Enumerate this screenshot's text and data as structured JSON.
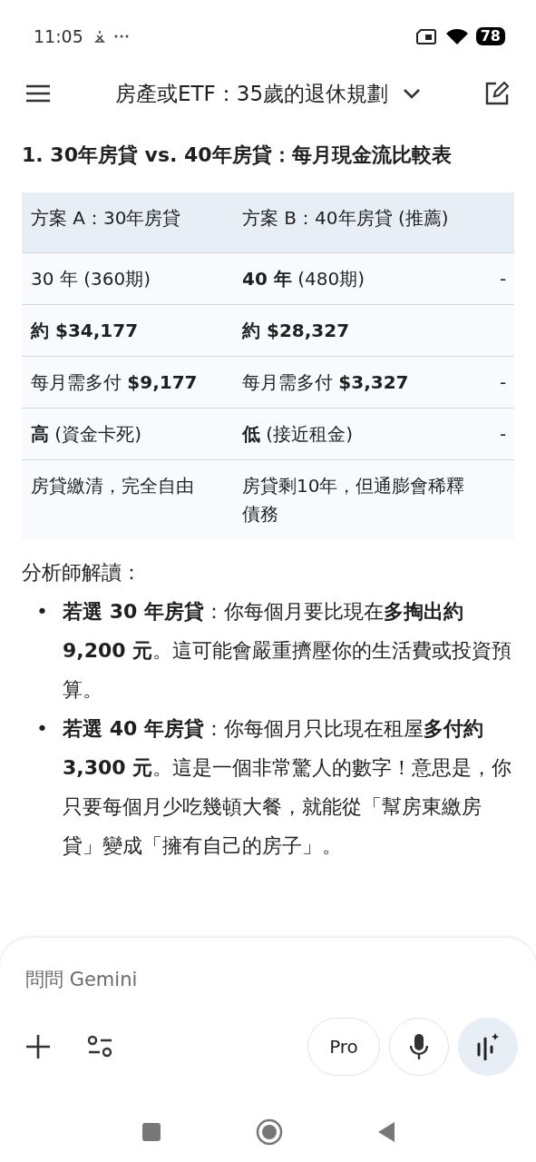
{
  "status_bar": {
    "time": "11:05",
    "battery": "78"
  },
  "app_bar": {
    "title": "房產或ETF：35歲的退休規劃"
  },
  "response": {
    "heading": "1. 30年房貸 vs. 40年房貸：每月現金流比較表",
    "table": {
      "columns": [
        "方案 A：30年房貸",
        "方案 B：40年房貸 (推薦)"
      ],
      "rows": [
        {
          "a": "30 年 (360期)",
          "b": "**40 年** (480期)",
          "column_3": "-"
        },
        {
          "a": "**約 $34,177**",
          "b": "**約 $28,327**"
        },
        {
          "a": "每月需多付 **$9,177**",
          "b": "每月需多付 **$3,327**",
          "column_3": "-"
        },
        {
          "a": "**高** (資金卡死)",
          "b": "**低** (接近租金)",
          "column_3": "-"
        },
        {
          "a": "房貸繳清，完全自由",
          "b": "房貸剩10年，但通膨會稀釋債務"
        }
      ]
    },
    "analysis_title": "分析師解讀：",
    "bullets": [
      {
        "marker": "•",
        "text": "**若選 30 年房貸**：你每個月要比現在**多掏出約 9,200 元**。這可能會嚴重擠壓你的生活費或投資預算。"
      },
      {
        "marker": "•",
        "text": "**若選 40 年房貸**：你每個月只比現在租屋**多付約 3,300 元**。這是一個非常驚人的數字！意思是，你只要每個月少吃幾頓大餐，就能從「幫房東繳房貸」變成「擁有自己的房子」。"
      }
    ]
  },
  "input_bar": {
    "placeholder": "問問 Gemini",
    "model": "Pro"
  }
}
